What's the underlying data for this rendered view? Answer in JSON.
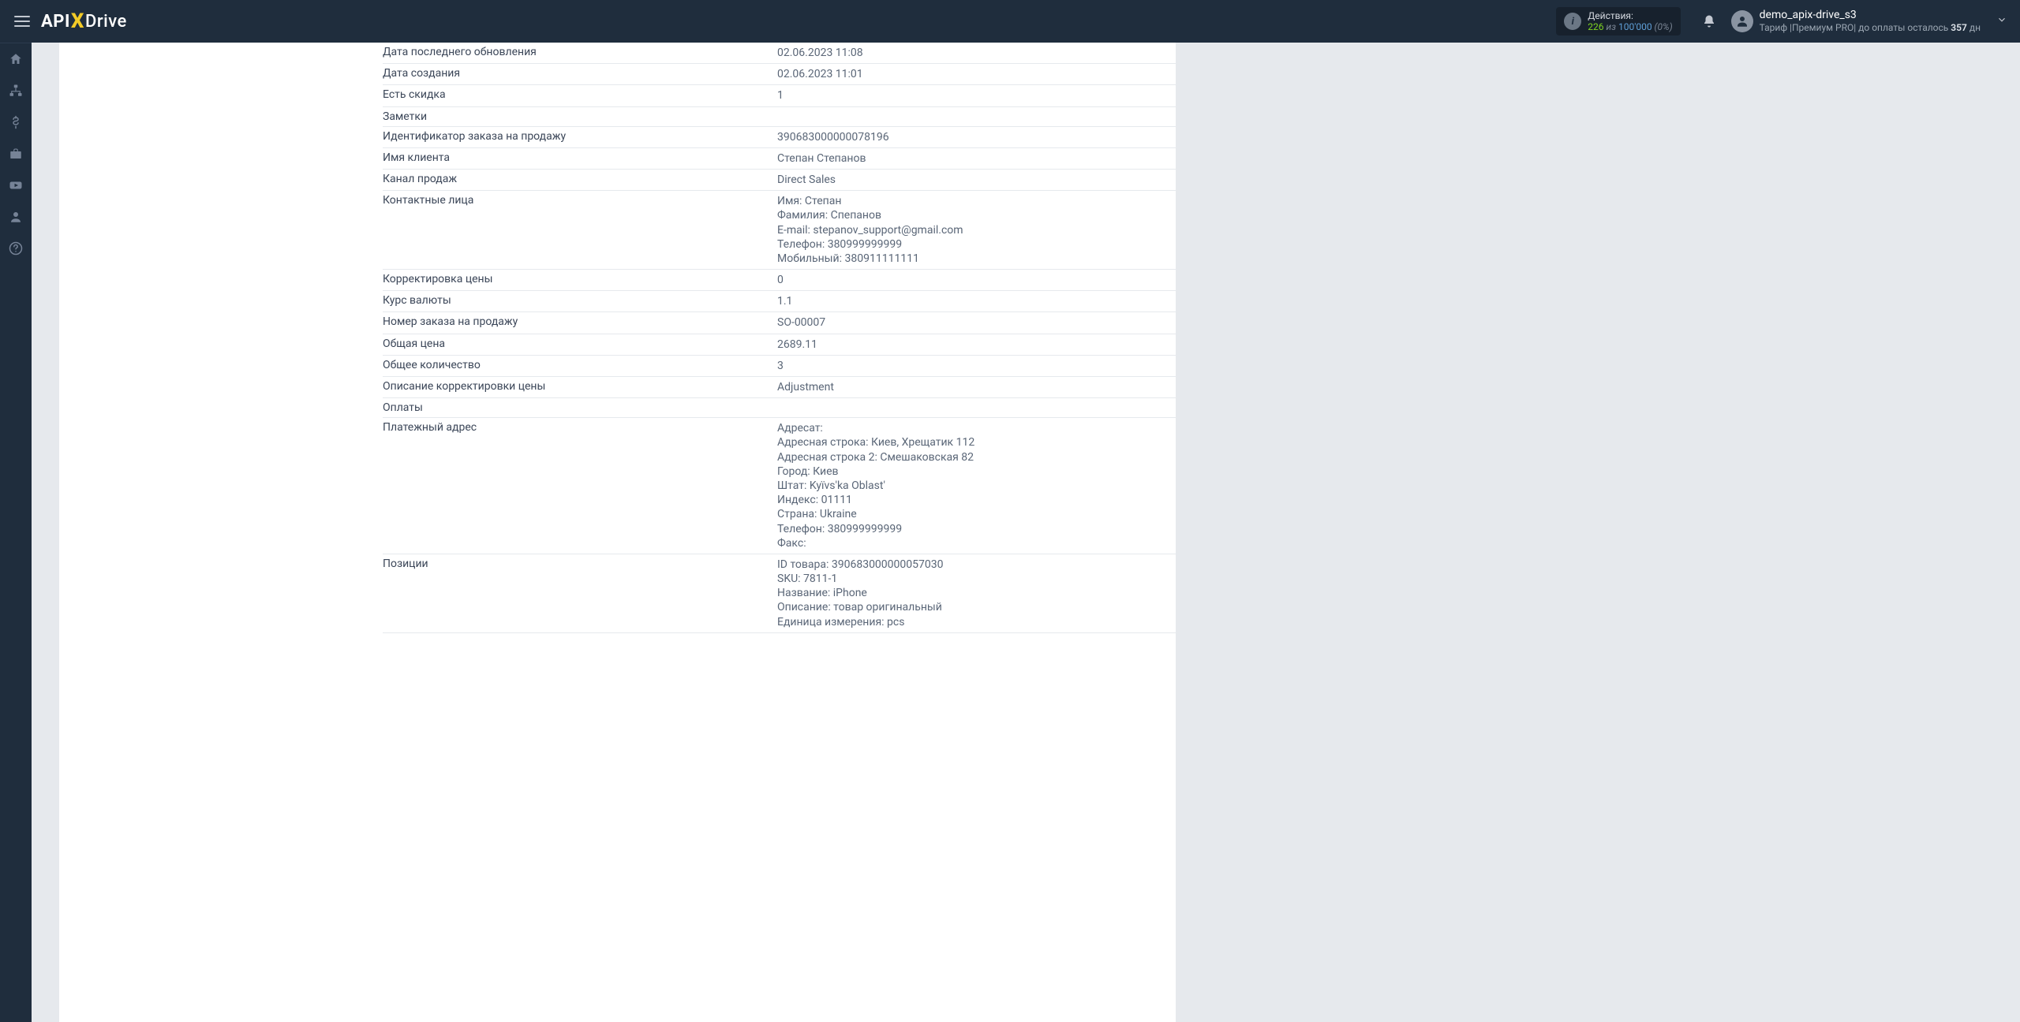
{
  "header": {
    "logo": {
      "api": "API",
      "x": "X",
      "drive": "Drive"
    },
    "actions": {
      "label": "Действия:",
      "count": "226",
      "of": " из ",
      "total": "100'000",
      "pct": " (0%)"
    },
    "user": {
      "name": "demo_apix-drive_s3",
      "tariff_label": "Тариф |",
      "tariff_name": "Премиум PRO",
      "after": "| до оплаты осталось ",
      "days": "357",
      "days_suffix": " дн"
    }
  },
  "rows": [
    {
      "label": "Дата последнего обновления",
      "value": "02.06.2023 11:08"
    },
    {
      "label": "Дата создания",
      "value": "02.06.2023 11:01"
    },
    {
      "label": "Есть скидка",
      "value": "1"
    },
    {
      "label": "Заметки",
      "value": ""
    },
    {
      "label": "Идентификатор заказа на продажу",
      "value": "390683000000078196"
    },
    {
      "label": "Имя клиента",
      "value": "Степан Степанов"
    },
    {
      "label": "Канал продаж",
      "value": "Direct Sales"
    },
    {
      "label": "Контактные лица",
      "value": "Имя: Степан\nФамилия: Спепанов\nE-mail: stepanov_support@gmail.com\nТелефон: 380999999999\nМобильный: 380911111111"
    },
    {
      "label": "Корректировка цены",
      "value": "0"
    },
    {
      "label": "Курс валюты",
      "value": "1.1"
    },
    {
      "label": "Номер заказа на продажу",
      "value": "SO-00007"
    },
    {
      "label": "Общая цена",
      "value": "2689.11"
    },
    {
      "label": "Общее количество",
      "value": "3"
    },
    {
      "label": "Описание корректировки цены",
      "value": "Adjustment"
    },
    {
      "label": "Оплаты",
      "value": ""
    },
    {
      "label": "Платежный адрес",
      "value": "Адресат:\nАдресная строка: Киев, Хрещатик 112\nАдресная строка 2: Смешаковская 82\nГород: Киев\nШтат: Kyïvs'ka Oblast'\nИндекс: 01111\nСтрана: Ukraine\nТелефон: 380999999999\nФакс:"
    },
    {
      "label": "Позиции",
      "value": "ID товара: 390683000000057030\nSKU: 7811-1\nНазвание: iPhone\nОписание: товар оригинальный\nЕдиница измерения: pcs"
    }
  ]
}
